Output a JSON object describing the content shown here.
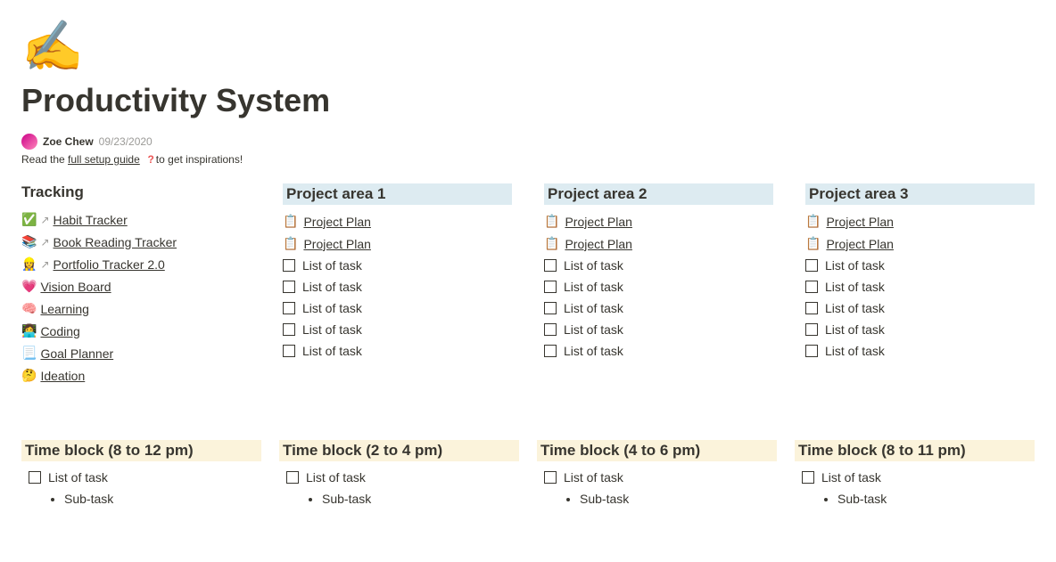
{
  "icon": "✍️",
  "title": "Productivity System",
  "author": "Zoe Chew",
  "date": "09/23/2020",
  "sub_prefix": "Read the ",
  "sub_link": "full setup guide",
  "sub_suffix": "to get inspirations!",
  "tracking": {
    "heading": "Tracking",
    "items": [
      {
        "emoji": "✅",
        "arrow": true,
        "label": "Habit Tracker"
      },
      {
        "emoji": "📚",
        "arrow": true,
        "label": "Book Reading Tracker"
      },
      {
        "emoji": "👷‍♀️",
        "arrow": true,
        "label": "Portfolio Tracker 2.0"
      },
      {
        "emoji": "💗",
        "arrow": false,
        "label": "Vision Board"
      },
      {
        "emoji": "🧠",
        "arrow": false,
        "label": "Learning"
      },
      {
        "emoji": "👩‍💻",
        "arrow": false,
        "label": "Coding"
      },
      {
        "emoji": "📃",
        "arrow": false,
        "label": "Goal Planner"
      },
      {
        "emoji": "🤔",
        "arrow": false,
        "label": "Ideation"
      }
    ]
  },
  "projects": [
    {
      "heading": "Project area 1",
      "plans": [
        "Project Plan",
        "Project Plan"
      ],
      "tasks": [
        "List of task",
        "List of task",
        "List of task",
        "List of task",
        "List of task"
      ]
    },
    {
      "heading": "Project area 2",
      "plans": [
        "Project Plan",
        "Project Plan"
      ],
      "tasks": [
        "List of task",
        "List of task",
        "List of task",
        "List of task",
        "List of task"
      ]
    },
    {
      "heading": "Project area 3",
      "plans": [
        "Project Plan",
        "Project Plan"
      ],
      "tasks": [
        "List of task",
        "List of task",
        "List of task",
        "List of task",
        "List of task"
      ]
    }
  ],
  "plan_emoji": "📋",
  "timeblocks": [
    {
      "heading": "Time block (8 to 12 pm)",
      "task": "List of task",
      "sub": "Sub-task"
    },
    {
      "heading": "Time block (2 to 4 pm)",
      "task": "List of task",
      "sub": "Sub-task"
    },
    {
      "heading": "Time block (4 to 6 pm)",
      "task": "List of task",
      "sub": "Sub-task"
    },
    {
      "heading": "Time block (8 to 11 pm)",
      "task": "List of task",
      "sub": "Sub-task"
    }
  ]
}
